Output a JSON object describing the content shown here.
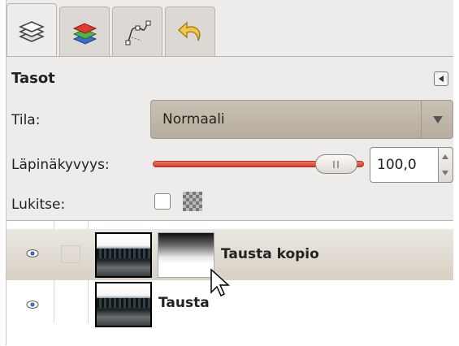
{
  "tabs": [
    {
      "id": "layers",
      "icon": "layers-icon",
      "active": true
    },
    {
      "id": "channels",
      "icon": "channels-icon",
      "active": false
    },
    {
      "id": "paths",
      "icon": "paths-icon",
      "active": false
    },
    {
      "id": "undo",
      "icon": "undo-icon",
      "active": false
    }
  ],
  "panel": {
    "title": "Tasot"
  },
  "mode": {
    "label": "Tila:",
    "value": "Normaali"
  },
  "opacity": {
    "label": "Läpinäkyvyys:",
    "value": "100,0",
    "fraction": 1.0
  },
  "lock": {
    "label": "Lukitse:",
    "checked": false
  },
  "layers": [
    {
      "name": "Tausta kopio",
      "visible": true,
      "selected": true,
      "has_mask": true
    },
    {
      "name": "Tausta",
      "visible": true,
      "selected": false,
      "has_mask": false
    }
  ],
  "colors": {
    "slider": "#d63a2a",
    "selected_row": "#d7d0c3",
    "combo": "#b7ad9d"
  }
}
